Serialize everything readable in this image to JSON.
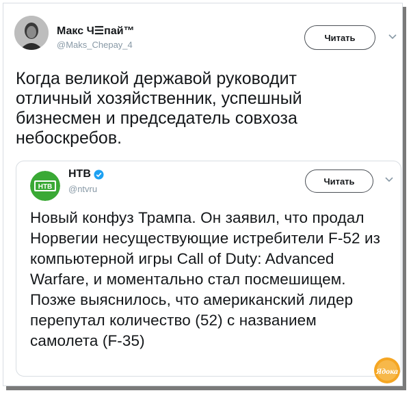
{
  "tweet": {
    "author_name": "Макс Ч☰пай™",
    "author_handle": "@Maks_Chepay_4",
    "follow_label": "Читать",
    "text": "Когда великой державой руководит отличный хозяйственник, успешный бизнесмен и председатель совхоза небоскребов."
  },
  "quote": {
    "author_name": "НТВ",
    "author_handle": "@ntvru",
    "follow_label": "Читать",
    "text": "Новый конфуз Трампа. Он заявил, что продал Норвегии несуществующие истребители F-52 из компьютерной игры Call of Duty: Advanced Warfare, и моментально стал посмешищем. Позже выяснилось, что американский лидер перепутал количество (52) с названием самолета (F-35)",
    "logo_text": "НТВ"
  },
  "watermark": {
    "text": "Ядока"
  },
  "colors": {
    "text": "#14171a",
    "secondary": "#8899a6",
    "border": "#d8dde2",
    "verified": "#1da1f2",
    "ntv_green": "#3aa935",
    "watermark_orange": "#f5a623"
  }
}
